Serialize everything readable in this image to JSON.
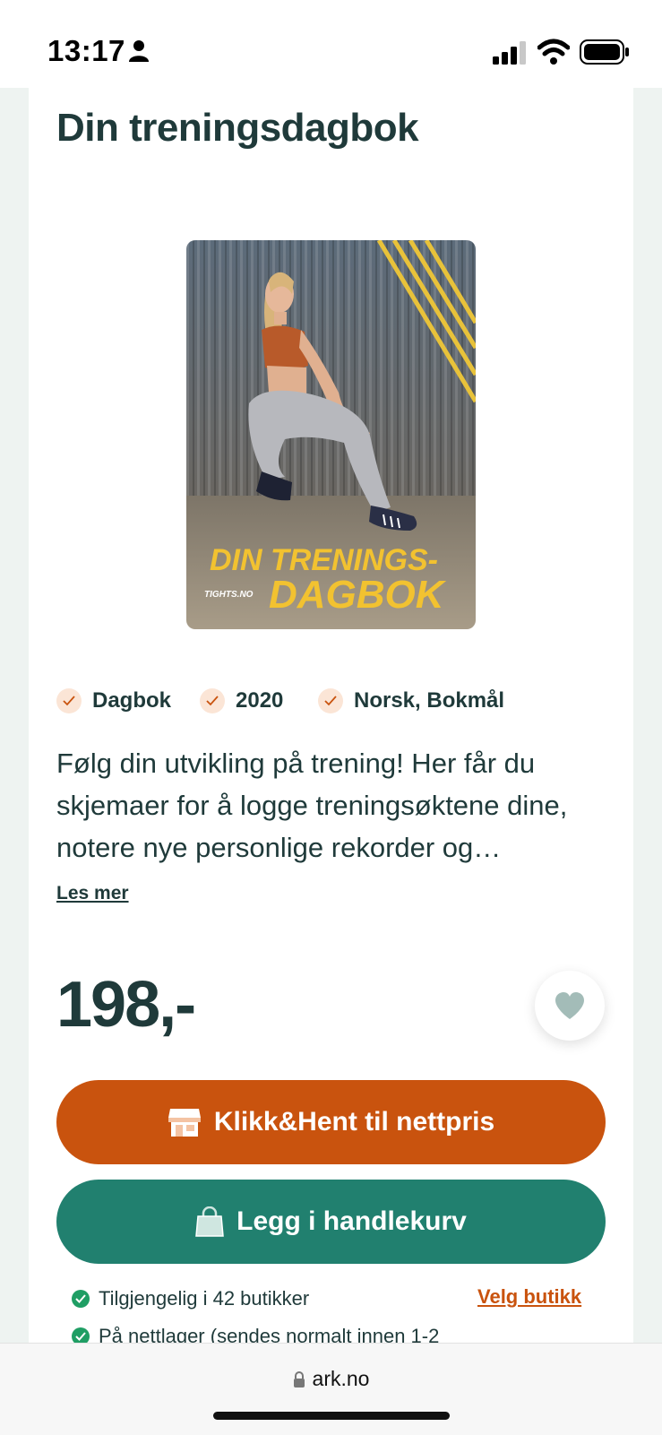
{
  "status_bar": {
    "time": "13:17"
  },
  "product": {
    "title": "Din treningsdagbok",
    "cover": {
      "line1": "DIN TRENINGS-",
      "line2": "DAGBOK",
      "publisher": "TIGHTS.NO"
    },
    "meta": [
      "Dagbok",
      "2020",
      "Norsk, Bokmål"
    ],
    "description": "Følg din utvikling på trening! Her får du skjemaer for å logge treningsøktene dine, notere nye personlige rekorder og…",
    "read_more": "Les mer",
    "price": "198,-"
  },
  "actions": {
    "click_collect": "Klikk&Hent til nettpris",
    "add_to_cart": "Legg i handlekurv"
  },
  "availability": {
    "stores": "Tilgjengelig i 42 butikker",
    "select_store": "Velg butikk",
    "online": "På nettlager (sendes normalt innen 1-2"
  },
  "browser": {
    "url": "ark.no"
  },
  "colors": {
    "accent_orange": "#c9530e",
    "accent_green": "#21806f",
    "text": "#1f3a3a"
  }
}
